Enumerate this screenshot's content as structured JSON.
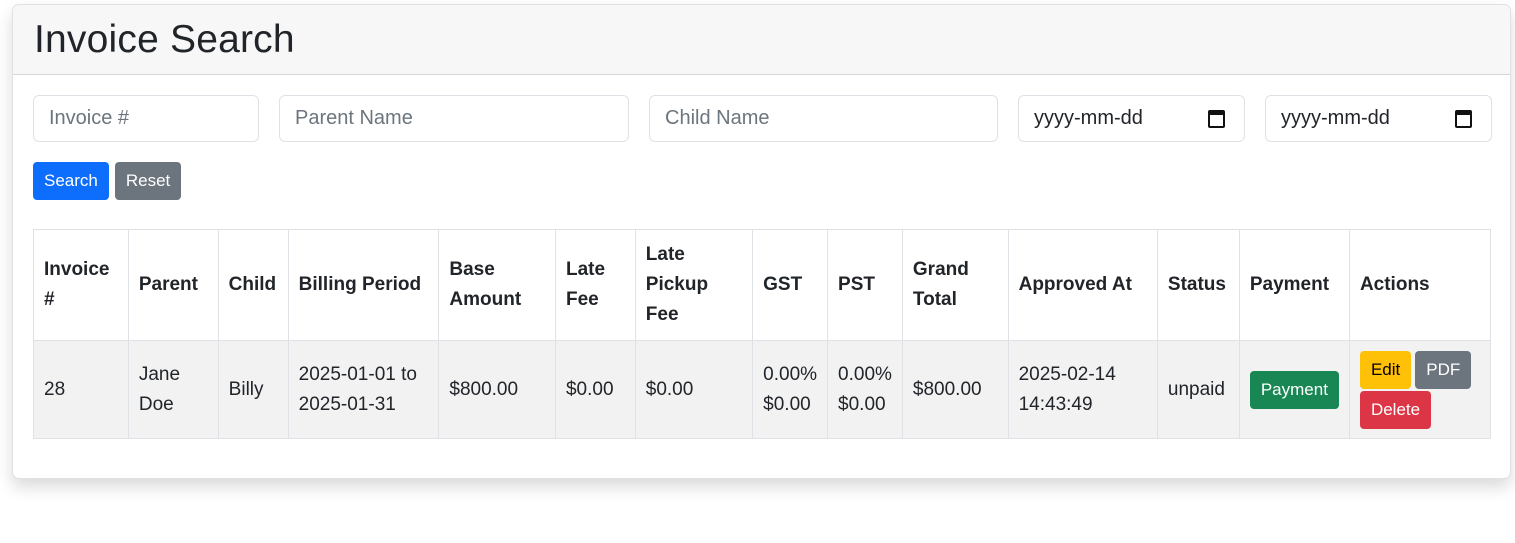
{
  "header": {
    "title": "Invoice Search"
  },
  "filters": {
    "invoice_placeholder": "Invoice #",
    "invoice_value": "",
    "parent_placeholder": "Parent Name",
    "parent_value": "",
    "child_placeholder": "Child Name",
    "child_value": "",
    "date_from_placeholder": "yyyy-mm-dd",
    "date_to_placeholder": "yyyy-mm-dd",
    "calendar_icon": "calendar-icon"
  },
  "buttons": {
    "search": "Search",
    "reset": "Reset"
  },
  "colors": {
    "primary": "#0d6efd",
    "secondary": "#6c757d",
    "success": "#198754",
    "warning": "#ffc107",
    "danger": "#dc3545"
  },
  "table": {
    "columns": [
      "Invoice #",
      "Parent",
      "Child",
      "Billing Period",
      "Base Amount",
      "Late Fee",
      "Late Pickup Fee",
      "GST",
      "PST",
      "Grand Total",
      "Approved At",
      "Status",
      "Payment",
      "Actions"
    ],
    "rows": [
      {
        "invoice": "28",
        "parent": "Jane Doe",
        "child": "Billy",
        "billing_period": "2025-01-01 to 2025-01-31",
        "base_amount": "$800.00",
        "late_fee": "$0.00",
        "late_pickup_fee": "$0.00",
        "gst_rate": "0.00%",
        "gst_amount": "$0.00",
        "pst_rate": "0.00%",
        "pst_amount": "$0.00",
        "grand_total": "$800.00",
        "approved_at": "2025-02-14 14:43:49",
        "status": "unpaid",
        "payment_label": "Payment",
        "actions": {
          "edit": "Edit",
          "pdf": "PDF",
          "delete": "Delete"
        }
      }
    ]
  }
}
